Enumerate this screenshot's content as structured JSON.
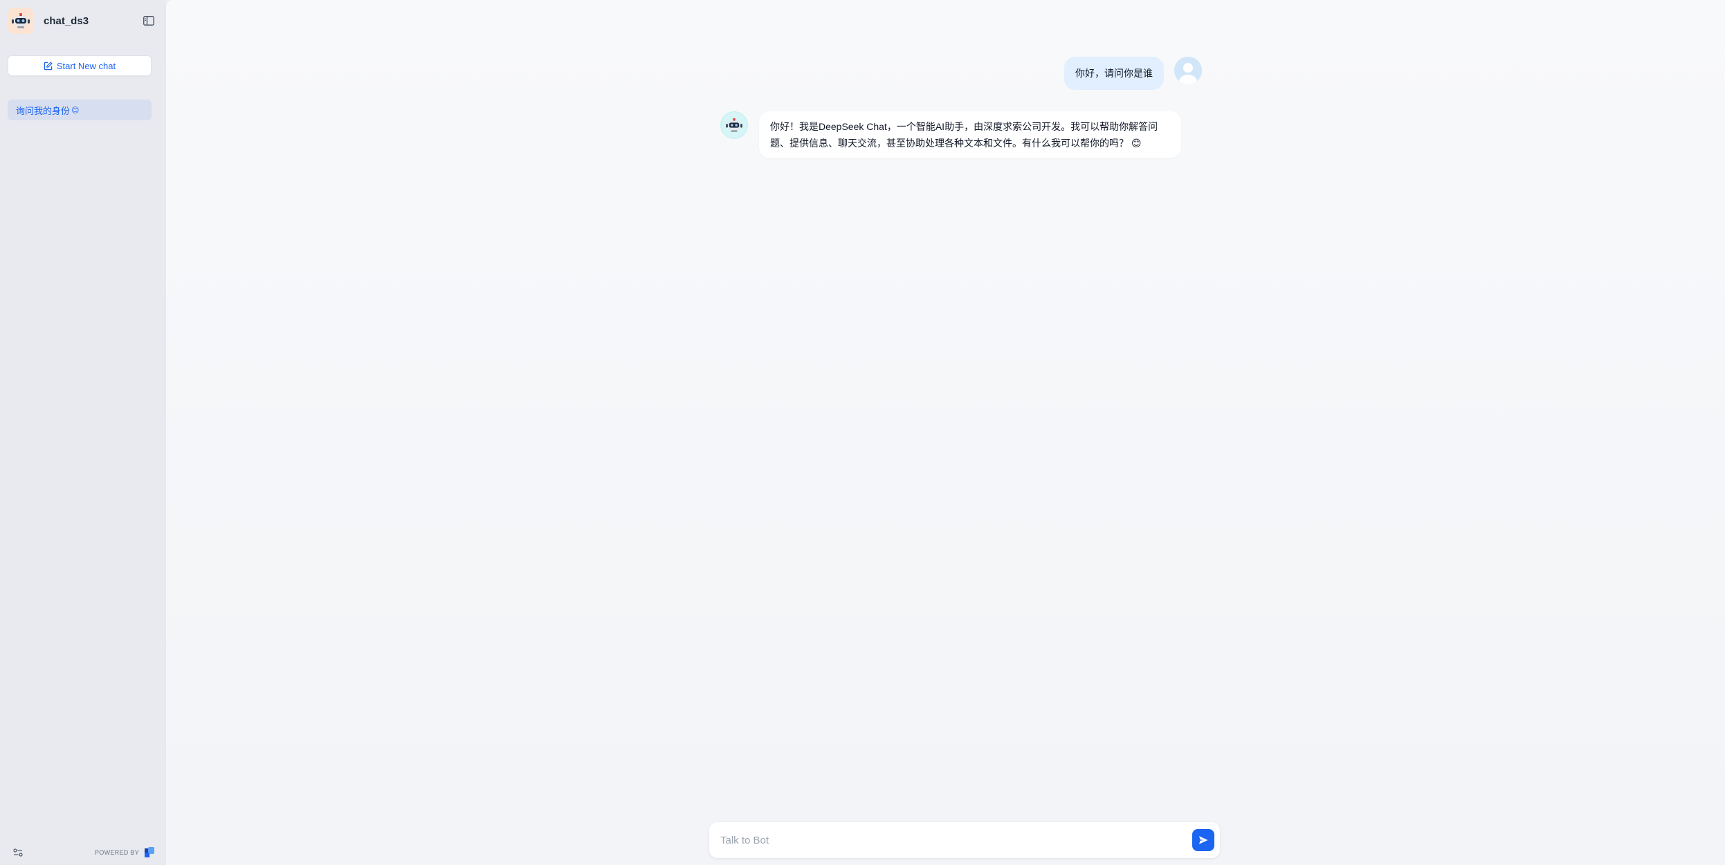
{
  "sidebar": {
    "app_name": "chat_ds3",
    "new_chat_label": "Start New chat",
    "conversations": [
      {
        "label": "询问我的身份",
        "emoji": "😊"
      }
    ],
    "powered_by": "POWERED BY"
  },
  "chat": {
    "user_message": "你好，请问你是谁",
    "bot_message": "你好！我是DeepSeek Chat，一个智能AI助手，由深度求索公司开发。我可以帮助你解答问题、提供信息、聊天交流，甚至协助处理各种文本和文件。有什么我可以帮你的吗？ 😊"
  },
  "input": {
    "placeholder": "Talk to Bot",
    "value": ""
  },
  "colors": {
    "accent": "#1c64f2",
    "user_bubble": "#e1effe",
    "selected_item": "#d7def0"
  },
  "icons": {
    "bot_avatar": "robot-icon",
    "collapse": "sidebar-collapse-icon",
    "new_chat": "edit-icon",
    "settings": "sliders-icon",
    "send": "send-icon",
    "user_avatar": "user-icon"
  }
}
